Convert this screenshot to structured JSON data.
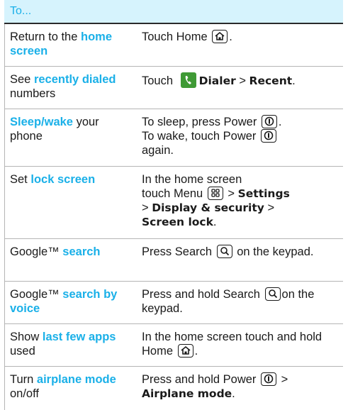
{
  "header": {
    "title": "To..."
  },
  "rows": [
    {
      "a1": "Return to the ",
      "a2": "home screen",
      "b1": "Touch Home ",
      "b2": "."
    },
    {
      "a1": "See ",
      "a2": "recently dialed",
      "a3": " numbers",
      "b1": "Touch ",
      "b2": "Dialer",
      "b3": " > ",
      "b4": "Recent",
      "b5": "."
    },
    {
      "a1": "Sleep/wake",
      "a2": " your phone",
      "b1": "To sleep, press Power ",
      "b2": ".",
      "b3": "To wake, touch Power ",
      "b4": "again."
    },
    {
      "a1": "Set ",
      "a2": "lock screen",
      "b1": "In the home screen",
      "b2": "touch Menu ",
      "b3": " > ",
      "b4": "Settings",
      "b5": "> ",
      "b6": "Display & security",
      "b7": " >",
      "b8": "Screen lock",
      "b9": "."
    },
    {
      "a1": "Google™ ",
      "a2": "search",
      "b1": "Press Search ",
      "b2": " on the keypad."
    },
    {
      "a1": "Google™ ",
      "a2": "search by voice",
      "b1": "Press and hold Search ",
      "b2": "on the keypad."
    },
    {
      "a1": "Show ",
      "a2": "last few apps",
      "a3": " used",
      "b1": "In the home screen touch and hold Home ",
      "b2": "."
    },
    {
      "a1": "Turn ",
      "a2": "airplane mode",
      "a3": " on/off",
      "b1": "Press and hold Power ",
      "b2": " > ",
      "b3": "Airplane mode",
      "b4": "."
    }
  ],
  "icons": {
    "home": "home-key-icon",
    "power": "power-key-icon",
    "menu": "menu-key-icon",
    "search": "search-key-icon",
    "dialer": "dialer-app-icon"
  },
  "colors": {
    "accent": "#1ab0e8",
    "header_bg": "#d6f3fd",
    "dialer_green": "#3f9a35"
  }
}
